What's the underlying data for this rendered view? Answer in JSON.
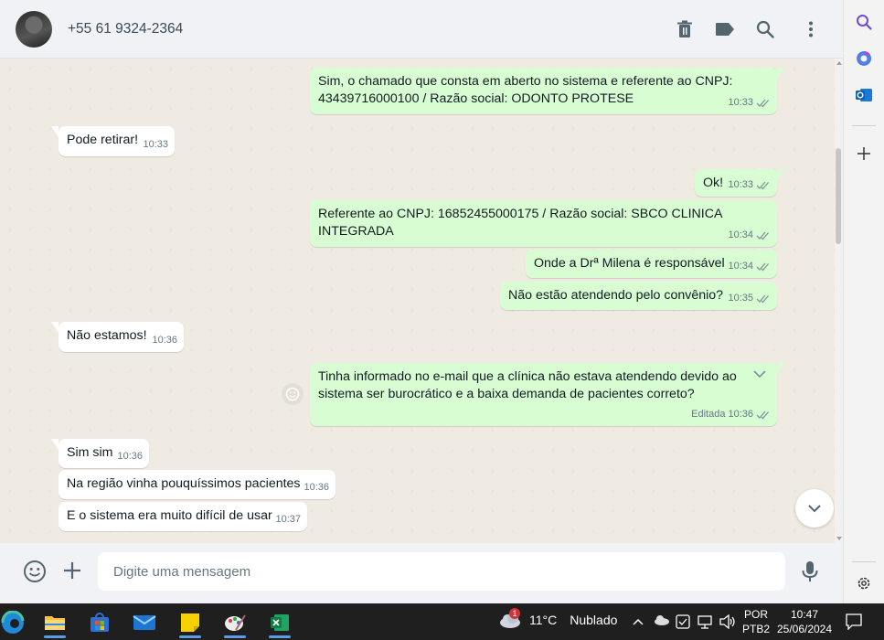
{
  "header": {
    "contact": "+55 61 9324-2364"
  },
  "messages": [
    {
      "dir": "out",
      "text": "Sim, o chamado que consta em aberto no sistema e referente ao CNPJ: 43439716000100 / Razão social: ODONTO PROTESE",
      "time": "10:33"
    },
    {
      "dir": "in",
      "text": "Pode retirar!",
      "time": "10:33"
    },
    {
      "dir": "out",
      "text": "Ok!",
      "time": "10:33"
    },
    {
      "dir": "out",
      "text": "Referente ao CNPJ: 16852455000175 / Razão social: SBCO CLINICA INTEGRADA",
      "time": "10:34"
    },
    {
      "dir": "out",
      "text": "Onde a Drª Milena é responsável",
      "time": "10:34"
    },
    {
      "dir": "out",
      "text": "Não estão atendendo pelo convênio?",
      "time": "10:35"
    },
    {
      "dir": "in",
      "text": "Não estamos!",
      "time": "10:36"
    },
    {
      "dir": "out",
      "text": "Tinha informado no e-mail que a clínica não estava atendendo devido ao sistema ser burocrático e a baixa demanda de pacientes correto?",
      "time": "10:36",
      "edited": "Editada"
    },
    {
      "dir": "in",
      "text": "Sim sim",
      "time": "10:36"
    },
    {
      "dir": "in",
      "text": "Na região vinha pouquíssimos pacientes",
      "time": "10:36"
    },
    {
      "dir": "in",
      "text": "E o sistema era muito difícil de usar",
      "time": "10:37"
    }
  ],
  "composer": {
    "placeholder": "Digite uma mensagem"
  },
  "taskbar": {
    "weather_temp": "11°C",
    "weather_desc": "Nublado",
    "weather_badge": "1",
    "lang_top": "POR",
    "lang_bottom": "PTB2",
    "time": "10:47",
    "date": "25/06/2024"
  },
  "colors": {
    "out_bubble": "#d9fdd3",
    "in_bubble": "#ffffff",
    "chat_bg": "#efeae2",
    "ticks": "#8696a0"
  },
  "icons": [
    "trash-icon",
    "label-icon",
    "search-icon",
    "more-vertical-icon",
    "emoji-icon",
    "plus-icon",
    "mic-icon",
    "chevron-down-icon",
    "gear-icon"
  ]
}
